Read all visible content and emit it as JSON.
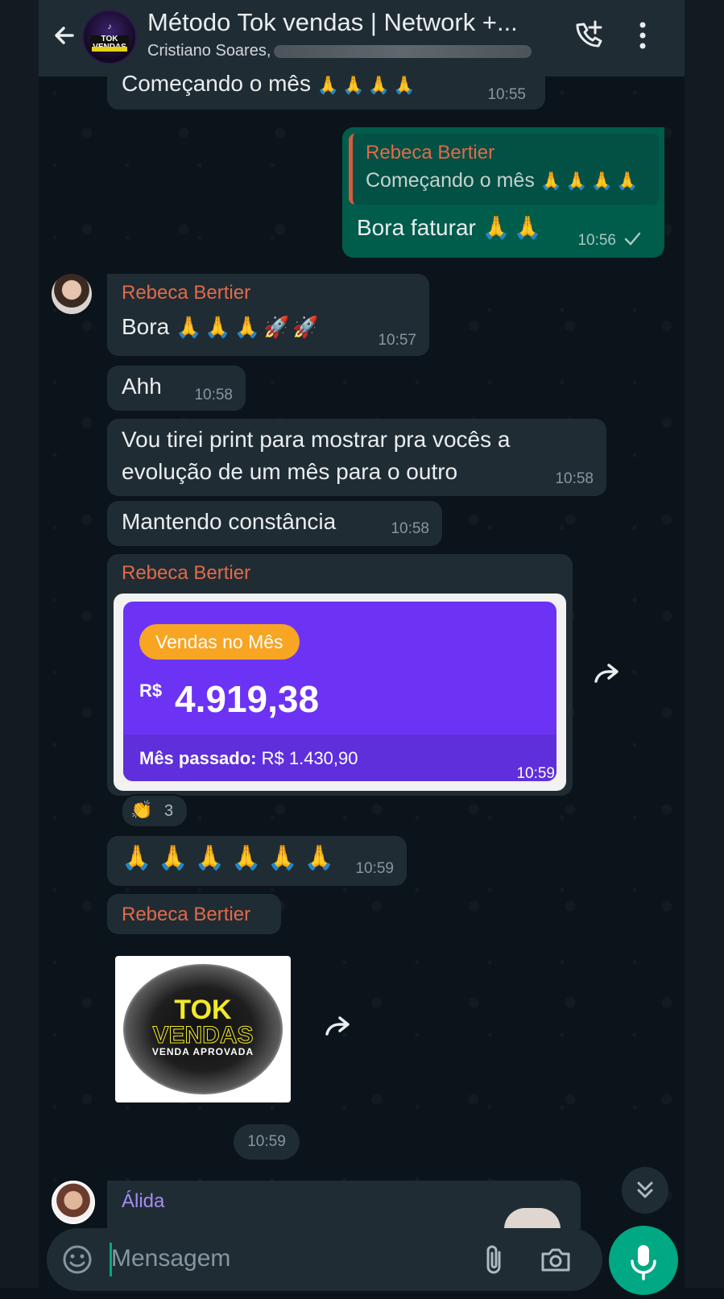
{
  "header": {
    "title": "Método Tok vendas | Network +...",
    "subtitle": "Cristiano Soares,",
    "avatar_text": "TOK VENDAS"
  },
  "messages": [
    {
      "text": "Começando o mês",
      "emoji": "🙏🙏🙏🙏",
      "time": "10:55"
    },
    {
      "quoted_sender": "Rebeca Bertier",
      "quoted_text": "Começando o mês",
      "quoted_emoji": "🙏🙏🙏🙏",
      "text": "Bora faturar",
      "emoji": "🙏🙏",
      "time": "10:56"
    },
    {
      "sender": "Rebeca Bertier",
      "text": "Bora",
      "emoji": "🙏🙏🙏🚀🚀",
      "time": "10:57"
    },
    {
      "text": "Ahh",
      "time": "10:58"
    },
    {
      "text": "Vou tirei print para mostrar pra vocês a evolução de um mês para o outro",
      "time": "10:58"
    },
    {
      "text": "Mantendo constância",
      "time": "10:58"
    },
    {
      "sender": "Rebeca Bertier",
      "time": "10:59"
    },
    {
      "emoji": "🙏🙏🙏🙏🙏🙏",
      "time": "10:59"
    },
    {
      "sender": "Rebeca Bertier",
      "time": "10:59"
    },
    {
      "sender": "Álida"
    }
  ],
  "sales_card": {
    "pill": "Vendas no Mês",
    "currency": "R$",
    "amount": "4.919,38",
    "last_label": "Mês passado:",
    "last_value": "R$ 1.430,90"
  },
  "reaction": {
    "emoji": "👏",
    "count": "3"
  },
  "image_sticker": {
    "line1": "TOK",
    "line2": "VENDAS",
    "line3": "VENDA APROVADA"
  },
  "composer": {
    "placeholder": "Mensagem"
  }
}
